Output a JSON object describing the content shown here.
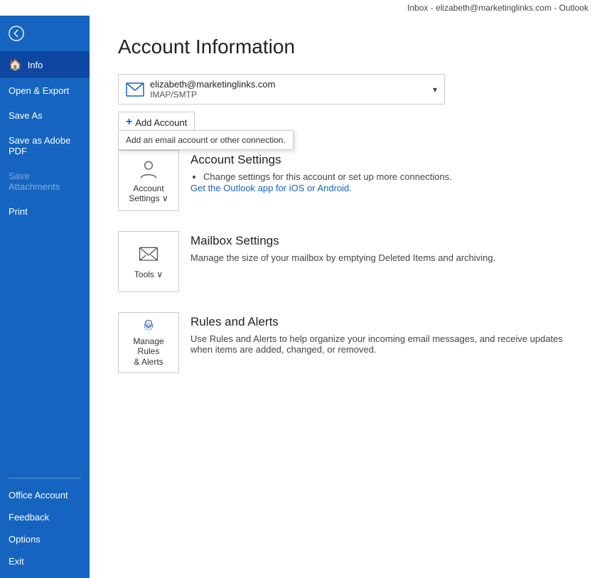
{
  "titlebar": {
    "text": "Inbox - elizabeth@marketinglinks.com - Outlook"
  },
  "sidebar": {
    "back_icon": "←",
    "nav_items": [
      {
        "id": "info",
        "label": "Info",
        "icon": "🏠",
        "active": true
      },
      {
        "id": "open-export",
        "label": "Open & Export",
        "active": false
      },
      {
        "id": "save-as",
        "label": "Save As",
        "active": false
      },
      {
        "id": "save-as-pdf",
        "label": "Save as Adobe PDF",
        "active": false
      },
      {
        "id": "save-attachments",
        "label": "Save Attachments",
        "active": false,
        "disabled": true
      },
      {
        "id": "print",
        "label": "Print",
        "active": false
      }
    ],
    "bottom_items": [
      {
        "id": "office-account",
        "label": "Office Account"
      },
      {
        "id": "feedback",
        "label": "Feedback"
      },
      {
        "id": "options",
        "label": "Options"
      },
      {
        "id": "exit",
        "label": "Exit"
      }
    ]
  },
  "content": {
    "page_title": "Account Information",
    "account": {
      "email": "elizabeth@marketinglinks.com",
      "type": "IMAP/SMTP"
    },
    "add_account_label": "Add Account",
    "add_account_tooltip": "Add an email account or other connection.",
    "sections": [
      {
        "id": "account-settings",
        "tile_label": "Account\nSettings",
        "has_chevron": true,
        "title": "Account Settings",
        "description": "Change settings for this account or set up more connections.",
        "link_text": "Get the Outlook app for iOS or Android.",
        "has_link": true
      },
      {
        "id": "mailbox-settings",
        "tile_label": "Tools",
        "has_chevron": true,
        "title": "Mailbox Settings",
        "description": "Manage the size of your mailbox by emptying Deleted Items and archiving.",
        "has_link": false
      },
      {
        "id": "rules-alerts",
        "tile_label": "Manage Rules\n& Alerts",
        "has_chevron": false,
        "title": "Rules and Alerts",
        "description": "Use Rules and Alerts to help organize your incoming email messages, and receive updates when items are added, changed, or removed.",
        "has_link": false
      }
    ]
  }
}
